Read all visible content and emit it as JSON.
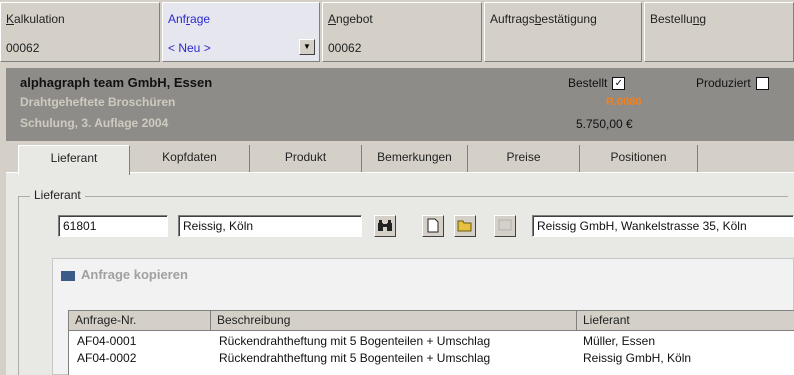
{
  "process": {
    "kalkulation": {
      "label_first": "K",
      "label_rest": "alkulation",
      "value": "00062"
    },
    "anfrage": {
      "label_first": "Anf",
      "label_u": "r",
      "label_rest": "age",
      "value": "< Neu >"
    },
    "angebot": {
      "label_first": "A",
      "label_rest": "ngebot",
      "value": "00062"
    },
    "auftrag": {
      "label_first": "Auftrags",
      "label_u": "b",
      "label_rest": "estätigung"
    },
    "bestellung": {
      "label_first": "Bestellu",
      "label_u": "n",
      "label_rest": "g"
    }
  },
  "header": {
    "company": "alphagraph team GmbH, Essen",
    "product": "Drahtgeheftete Broschüren",
    "job": "Schulung, 3. Auflage 2004",
    "bestellt_label": "Bestellt",
    "bestellt_checked": true,
    "produziert_label": "Produziert",
    "produziert_checked": false,
    "status_value": "R.0080",
    "price": "5.750,00 €",
    "colors": {
      "band": "#8e8c88",
      "status": "#f08020",
      "active_step": "#2a2ad0"
    }
  },
  "tabs": [
    "Lieferant",
    "Kopfdaten",
    "Produkt",
    "Bemerkungen",
    "Preise",
    "Positionen"
  ],
  "active_tab": "Lieferant",
  "lieferant": {
    "legend": "Lieferant",
    "number": "61801",
    "name": "Reissig, Köln",
    "address": "Reissig GmbH, Wankelstrasse 35, Köln",
    "icons": [
      "binoculars-icon",
      "new-document-icon",
      "open-folder-icon",
      "disabled-action-icon"
    ]
  },
  "copy_dialog": {
    "title": "Anfrage kopieren",
    "columns": [
      "Anfrage-Nr.",
      "Beschreibung",
      "Lieferant"
    ],
    "rows": [
      [
        "AF04-0001",
        "Rückendrahtheftung mit 5 Bogenteilen + Umschlag",
        "Müller, Essen"
      ],
      [
        "AF04-0002",
        "Rückendrahtheftung mit 5 Bogenteilen + Umschlag",
        "Reissig GmbH, Köln"
      ]
    ]
  }
}
